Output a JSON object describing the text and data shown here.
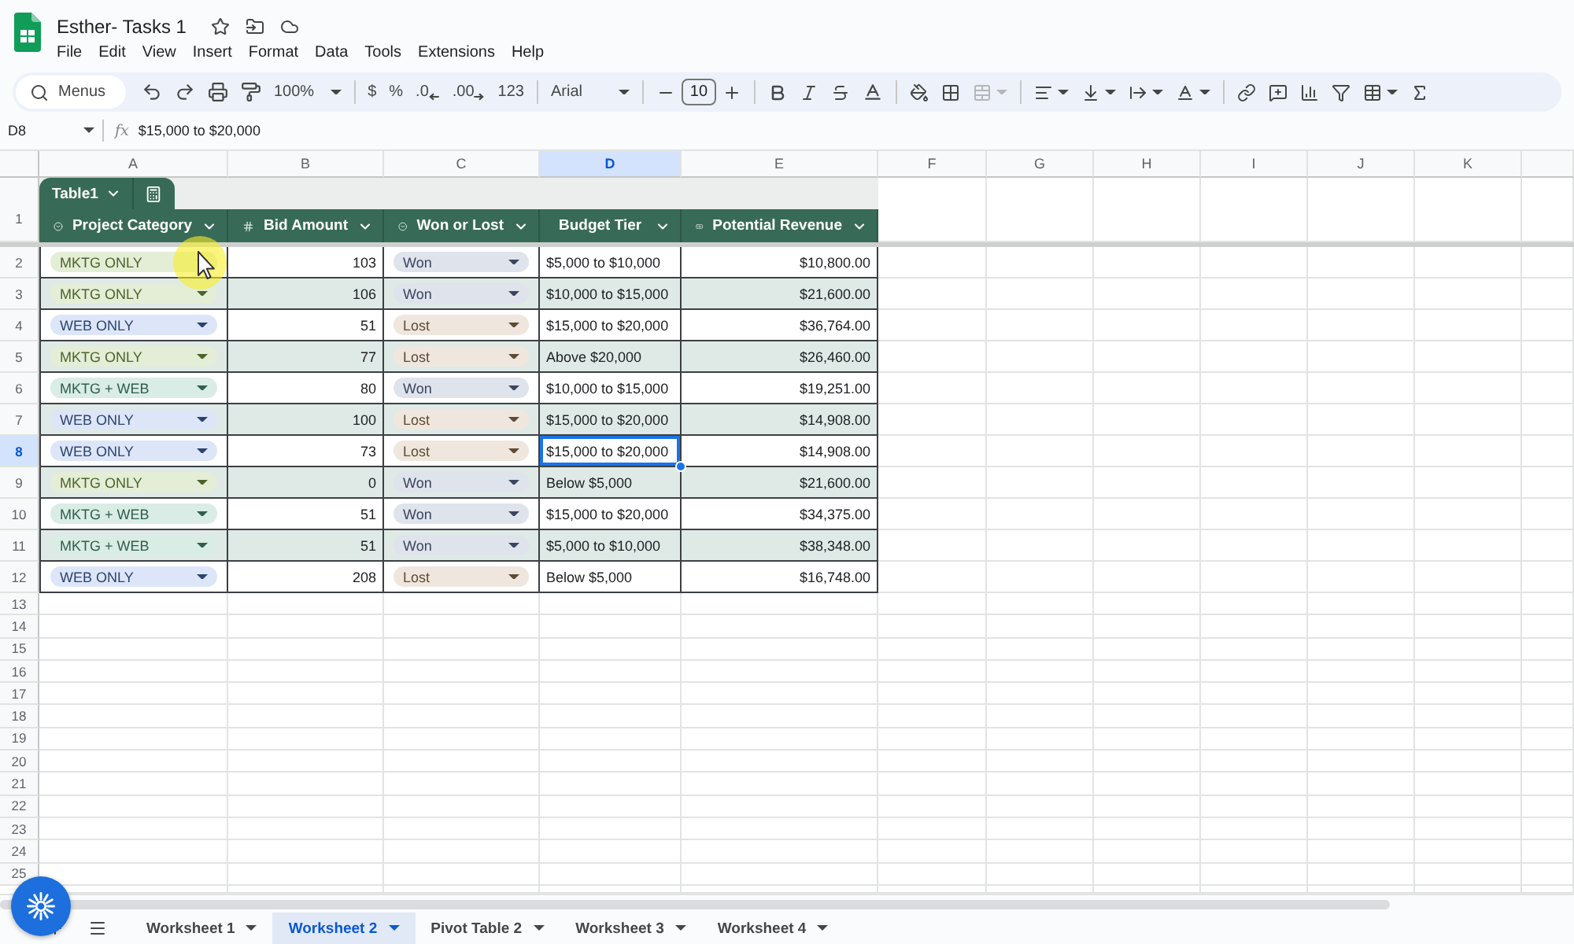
{
  "document": {
    "title": "Esther- Tasks 1"
  },
  "menu": [
    "File",
    "Edit",
    "View",
    "Insert",
    "Format",
    "Data",
    "Tools",
    "Extensions",
    "Help"
  ],
  "toolbar": {
    "search": {
      "placeholder": "Menus"
    },
    "zoom": "100%",
    "currency": "$",
    "percent": "%",
    "decrease_decimals": ".0",
    "increase_decimals": ".00",
    "number_format": "123",
    "font": "Arial",
    "font_size": "10",
    "merge_cells": {
      "disabled": true
    }
  },
  "formula_bar": {
    "cell_reference": "D8",
    "function_label": "fx",
    "value": "$15,000 to $20,000"
  },
  "columns": [
    {
      "letter": "A",
      "selected": false
    },
    {
      "letter": "B",
      "selected": false
    },
    {
      "letter": "C",
      "selected": false
    },
    {
      "letter": "D",
      "selected": true
    },
    {
      "letter": "E",
      "selected": false
    },
    {
      "letter": "F",
      "selected": false
    },
    {
      "letter": "G",
      "selected": false
    },
    {
      "letter": "H",
      "selected": false
    },
    {
      "letter": "I",
      "selected": false
    },
    {
      "letter": "J",
      "selected": false
    },
    {
      "letter": "K",
      "selected": false
    }
  ],
  "table": {
    "name": "Table1",
    "header_row": "1",
    "columns": [
      {
        "title": "Project Category",
        "kind": "dropdown"
      },
      {
        "title": "Bid Amount",
        "kind": "number"
      },
      {
        "title": "Won or Lost",
        "kind": "dropdown"
      },
      {
        "title": "Budget Tier",
        "kind": "text"
      },
      {
        "title": "Potential Revenue",
        "kind": "currency"
      }
    ],
    "rows": [
      {
        "number": "2",
        "selected": false,
        "cells": [
          {
            "text": "MKTG ONLY",
            "color": "#e4edd6"
          },
          {
            "text": "103"
          },
          {
            "text": "Won",
            "color": "#dfe3ec"
          },
          {
            "text": "$5,000 to $10,000"
          },
          {
            "text": "$10,800.00"
          }
        ]
      },
      {
        "number": "3",
        "selected": false,
        "cells": [
          {
            "text": "MKTG ONLY",
            "color": "#e4edd6"
          },
          {
            "text": "106"
          },
          {
            "text": "Won",
            "color": "#dfe3ec"
          },
          {
            "text": "$10,000 to $15,000"
          },
          {
            "text": "$21,600.00"
          }
        ]
      },
      {
        "number": "4",
        "selected": false,
        "cells": [
          {
            "text": "WEB ONLY",
            "color": "#dde6f8"
          },
          {
            "text": "51"
          },
          {
            "text": "Lost",
            "color": "#efe7de"
          },
          {
            "text": "$15,000 to $20,000"
          },
          {
            "text": "$36,764.00"
          }
        ]
      },
      {
        "number": "5",
        "selected": false,
        "cells": [
          {
            "text": "MKTG ONLY",
            "color": "#e4edd6"
          },
          {
            "text": "77"
          },
          {
            "text": "Lost",
            "color": "#efe7de"
          },
          {
            "text": "Above $20,000"
          },
          {
            "text": "$26,460.00"
          }
        ]
      },
      {
        "number": "6",
        "selected": false,
        "cells": [
          {
            "text": "MKTG + WEB",
            "color": "#d9ece5"
          },
          {
            "text": "80"
          },
          {
            "text": "Won",
            "color": "#dfe3ec"
          },
          {
            "text": "$10,000 to $15,000"
          },
          {
            "text": "$19,251.00"
          }
        ]
      },
      {
        "number": "7",
        "selected": false,
        "cells": [
          {
            "text": "WEB ONLY",
            "color": "#dde6f8"
          },
          {
            "text": "100"
          },
          {
            "text": "Lost",
            "color": "#efe7de"
          },
          {
            "text": "$15,000 to $20,000"
          },
          {
            "text": "$14,908.00"
          }
        ]
      },
      {
        "number": "8",
        "selected": true,
        "cells": [
          {
            "text": "WEB ONLY",
            "color": "#dde6f8"
          },
          {
            "text": "73"
          },
          {
            "text": "Lost",
            "color": "#efe7de"
          },
          {
            "text": "$15,000 to $20,000"
          },
          {
            "text": "$14,908.00"
          }
        ]
      },
      {
        "number": "9",
        "selected": false,
        "cells": [
          {
            "text": "MKTG ONLY",
            "color": "#e4edd6"
          },
          {
            "text": "0"
          },
          {
            "text": "Won",
            "color": "#dfe3ec"
          },
          {
            "text": "Below $5,000"
          },
          {
            "text": "$21,600.00"
          }
        ]
      },
      {
        "number": "10",
        "selected": false,
        "cells": [
          {
            "text": "MKTG + WEB",
            "color": "#d9ece5"
          },
          {
            "text": "51"
          },
          {
            "text": "Won",
            "color": "#dfe3ec"
          },
          {
            "text": "$15,000 to $20,000"
          },
          {
            "text": "$34,375.00"
          }
        ]
      },
      {
        "number": "11",
        "selected": false,
        "cells": [
          {
            "text": "MKTG + WEB",
            "color": "#d9ece5"
          },
          {
            "text": "51"
          },
          {
            "text": "Won",
            "color": "#dfe3ec"
          },
          {
            "text": "$5,000 to $10,000"
          },
          {
            "text": "$38,348.00"
          }
        ]
      },
      {
        "number": "12",
        "selected": false,
        "cells": [
          {
            "text": "WEB ONLY",
            "color": "#dde6f8"
          },
          {
            "text": "208"
          },
          {
            "text": "Lost",
            "color": "#efe7de"
          },
          {
            "text": "Below $5,000"
          },
          {
            "text": "$16,748.00"
          }
        ]
      }
    ]
  },
  "empty_rows": [
    "13",
    "14",
    "15",
    "16",
    "17",
    "18",
    "19",
    "20",
    "21",
    "22",
    "23",
    "24",
    "25"
  ],
  "sheets": [
    {
      "name": "Worksheet 1",
      "selected": false
    },
    {
      "name": "Worksheet 2",
      "selected": true
    },
    {
      "name": "Pivot Table 2",
      "selected": false
    },
    {
      "name": "Worksheet 3",
      "selected": false
    },
    {
      "name": "Worksheet 4",
      "selected": false
    }
  ]
}
